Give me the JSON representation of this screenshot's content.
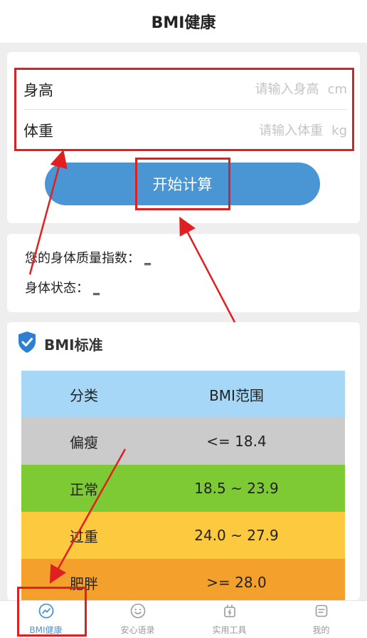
{
  "header": {
    "title": "BMI健康"
  },
  "form": {
    "height": {
      "label": "身高",
      "placeholder": "请输入身高",
      "unit": "cm"
    },
    "weight": {
      "label": "体重",
      "placeholder": "请输入体重",
      "unit": "kg"
    },
    "calc_label": "开始计算"
  },
  "result": {
    "bmi_label": "您的身体质量指数：",
    "bmi_value": "_",
    "status_label": "身体状态：",
    "status_value": "_"
  },
  "standard": {
    "title": "BMI标准",
    "header": {
      "category": "分类",
      "range": "BMI范围"
    },
    "rows": [
      {
        "category": "偏瘦",
        "range": "<= 18.4",
        "color": "#cbcbcb"
      },
      {
        "category": "正常",
        "range": "18.5 ~ 23.9",
        "color": "#7dca34"
      },
      {
        "category": "过重",
        "range": "24.0 ~ 27.9",
        "color": "#fcc93f"
      },
      {
        "category": "肥胖",
        "range": ">= 28.0",
        "color": "#f3a12c"
      }
    ],
    "header_color": "#a7d7f6"
  },
  "tabs": [
    {
      "label": "BMI健康",
      "icon": "trend-icon",
      "active": true
    },
    {
      "label": "安心语录",
      "icon": "smile-icon",
      "active": false
    },
    {
      "label": "实用工具",
      "icon": "tool-icon",
      "active": false
    },
    {
      "label": "我的",
      "icon": "profile-icon",
      "active": false
    }
  ],
  "colors": {
    "accent": "#4a96d4",
    "annotation": "#e02020"
  }
}
